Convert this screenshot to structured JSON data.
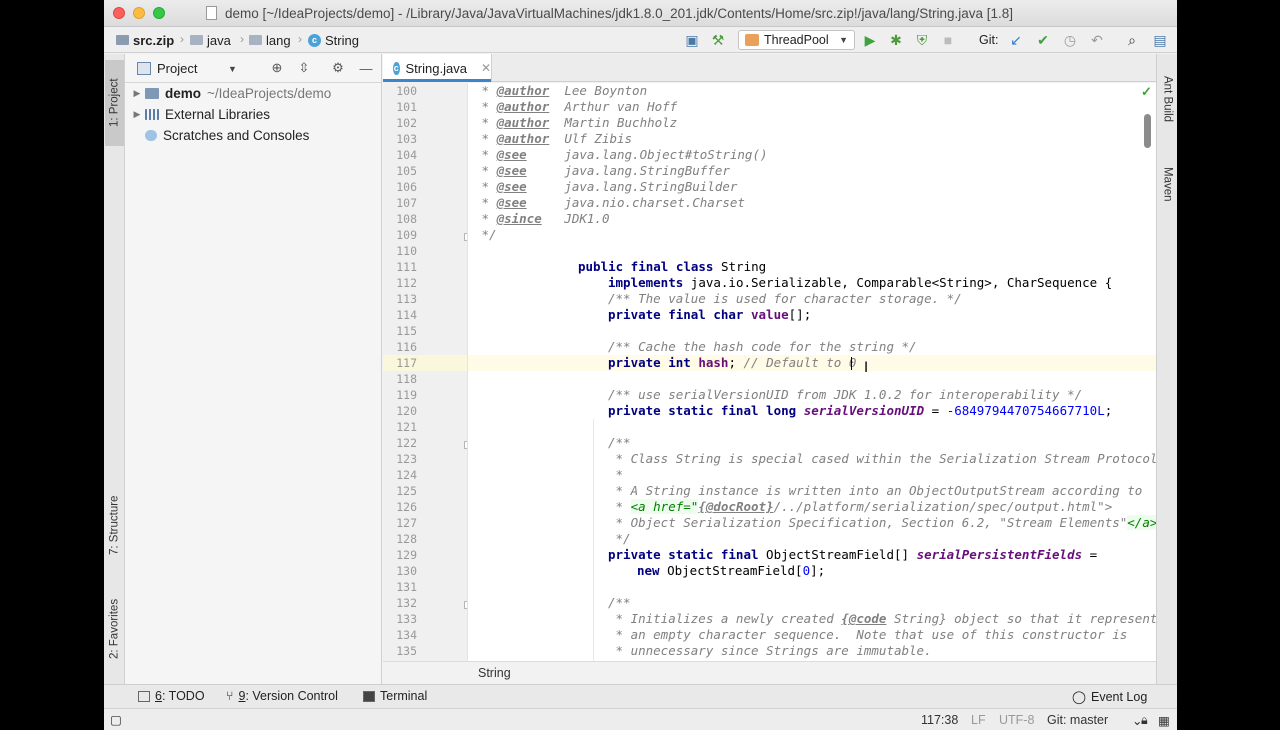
{
  "window": {
    "title": "demo [~/IdeaProjects/demo] - /Library/Java/JavaVirtualMachines/jdk1.8.0_201.jdk/Contents/Home/src.zip!/java/lang/String.java [1.8]"
  },
  "navbar": {
    "crumbs": [
      "src.zip",
      "java",
      "lang",
      "String"
    ],
    "run_config": "ThreadPool",
    "git_label": "Git:"
  },
  "left_strip": {
    "project": "1: Project",
    "structure": "7: Structure",
    "favorites": "2: Favorites"
  },
  "right_strip": {
    "ant": "Ant Build",
    "maven": "Maven"
  },
  "project_panel": {
    "title": "Project",
    "tree": [
      {
        "label": "demo",
        "path": "~/IdeaProjects/demo"
      },
      {
        "label": "External Libraries"
      },
      {
        "label": "Scratches and Consoles"
      }
    ]
  },
  "editor": {
    "tab_label": "String.java",
    "line_numbers": [
      "100",
      "101",
      "102",
      "103",
      "104",
      "105",
      "106",
      "107",
      "108",
      "109",
      "110",
      "111",
      "112",
      "113",
      "114",
      "115",
      "116",
      "117",
      "118",
      "119",
      "120",
      "121",
      "122",
      "123",
      "124",
      "125",
      "126",
      "127",
      "128",
      "129",
      "130",
      "131",
      "132",
      "133",
      "134",
      "135"
    ],
    "code": {
      "l100_tag": "@author",
      "l100_val": "  Lee Boynton",
      "l101_tag": "@author",
      "l101_val": "  Arthur van Hoff",
      "l102_tag": "@author",
      "l102_val": "  Martin Buchholz",
      "l103_tag": "@author",
      "l103_val": "  Ulf Zibis",
      "l104_tag": "@see",
      "l104_val": "     java.lang.Object#toString()",
      "l105_tag": "@see",
      "l105_val": "     java.lang.StringBuffer",
      "l106_tag": "@see",
      "l106_val": "     java.lang.StringBuilder",
      "l107_tag": "@see",
      "l107_val": "     java.nio.charset.Charset",
      "l108_tag": "@since",
      "l108_val": "   JDK1.0",
      "l109": " */",
      "l111_kw": "public final class",
      "l111_rest": " String",
      "l112_kw": "implements",
      "l112_rest": " java.io.Serializable, Comparable<String>, CharSequence {",
      "l113": "/** The value is used for character storage. */",
      "l114_kw": "private final char",
      "l114_field": "value",
      "l114_rest": "[];",
      "l116": "/** Cache the hash code for the string */",
      "l117_kw": "private int",
      "l117_field": "hash",
      "l117_rest": "; ",
      "l117_comment": "// Default to 0",
      "l119": "/** use serialVersionUID from JDK 1.0.2 for interoperability */",
      "l120_kw": "private static final long",
      "l120_field": "serialVersionUID",
      "l120_eq": " = ",
      "l120_num": "-6849794470754667710L",
      "l120_end": ";",
      "l122": "/**",
      "l123": " * Class String is special cased within the Serialization Stream Protocol.",
      "l124": " *",
      "l125": " * A String instance is written into an ObjectOutputStream according to",
      "l126_pre": " * ",
      "l126_a": "<a href=\"",
      "l126_doc": "{@docRoot}",
      "l126_a2": "/../platform/serialization/spec/output.html\">",
      "l127_pre": " * Object Serialization Specification, Section 6.2, \"Stream Elements\"",
      "l127_end": "</a>",
      "l128": " */",
      "l129_kw": "private static final",
      "l129_type": " ObjectStreamField[] ",
      "l129_field": "serialPersistentFields",
      "l129_rest": " =",
      "l130_kw": "new",
      "l130_rest": " ObjectStreamField[",
      "l130_num": "0",
      "l130_end": "];",
      "l132": "/**",
      "l133_pre": " * Initializes a newly created ",
      "l133_code": "{@code",
      "l133_rest": " String} object so that it represents",
      "l134": " * an empty character sequence.  Note that use of this constructor is",
      "l135": " * unnecessary since Strings are immutable."
    },
    "breadcrumb": "String"
  },
  "bottom_tools": {
    "todo_num": "6",
    "todo_label": ": TODO",
    "vc_num": "9",
    "vc_label": ": Version Control",
    "terminal": "Terminal",
    "event_log": "Event Log"
  },
  "status": {
    "position": "117:38",
    "line_sep": "LF",
    "encoding": "UTF-8",
    "git_branch": "Git: master"
  },
  "colors": {
    "keyword": "#000080",
    "comment": "#808080",
    "field": "#660e7a",
    "number": "#0000ff",
    "html_tag": "#008000",
    "accent": "#4083c9"
  }
}
